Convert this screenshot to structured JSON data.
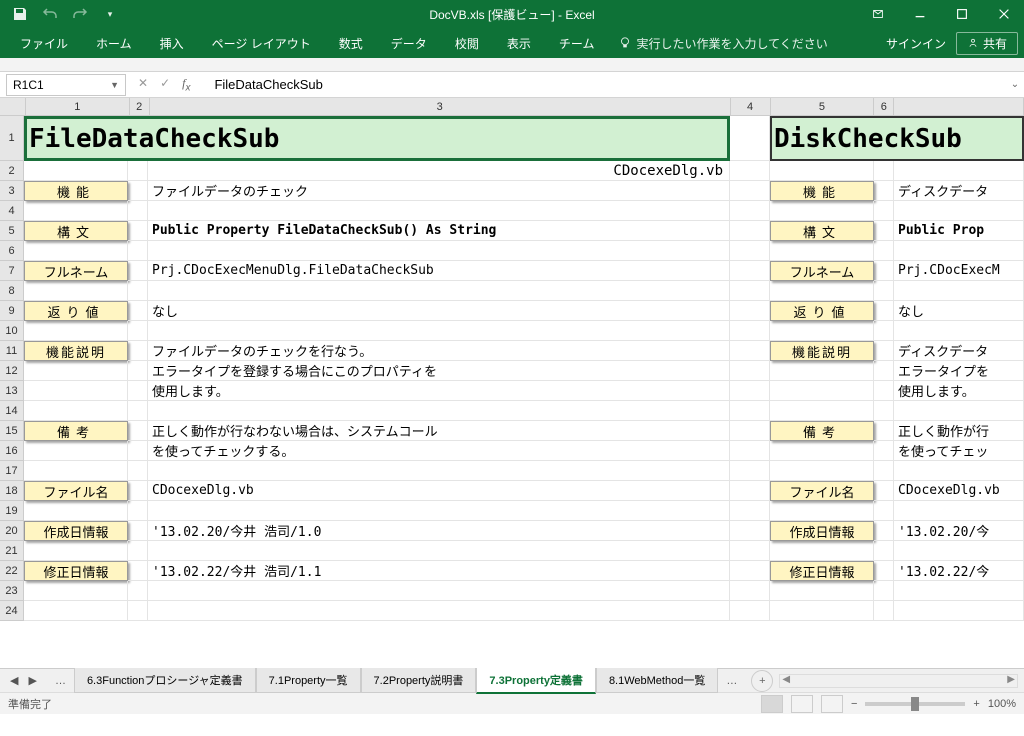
{
  "titlebar": {
    "title": "DocVB.xls [保護ビュー] - Excel"
  },
  "ribbon": {
    "tabs": [
      "ファイル",
      "ホーム",
      "挿入",
      "ページ レイアウト",
      "数式",
      "データ",
      "校閲",
      "表示",
      "チーム"
    ],
    "tellme": "実行したい作業を入力してください",
    "signin": "サインイン",
    "share": "共有"
  },
  "namebox": "R1C1",
  "formula": "FileDataCheckSub",
  "cols": [
    "1",
    "2",
    "3",
    "4",
    "5",
    "6",
    ""
  ],
  "rows": [
    "1",
    "2",
    "3",
    "4",
    "5",
    "6",
    "7",
    "8",
    "9",
    "10",
    "11",
    "12",
    "13",
    "14",
    "15",
    "16",
    "17",
    "18",
    "19",
    "20",
    "21",
    "22",
    "23",
    "24"
  ],
  "left": {
    "title": "FileDataCheckSub",
    "subtitle": "CDocexeDlg.vb",
    "labels": {
      "func": "機能",
      "syntax": "構文",
      "fullname": "フルネーム",
      "return": "返り値",
      "desc": "機能説明",
      "remark": "備考",
      "file": "ファイル名",
      "created": "作成日情報",
      "modified": "修正日情報"
    },
    "values": {
      "func": "ファイルデータのチェック",
      "syntax": "Public Property FileDataCheckSub() As String",
      "fullname": "Prj.CDocExecMenuDlg.FileDataCheckSub",
      "return": "なし",
      "desc1": "ファイルデータのチェックを行なう。",
      "desc2": "エラータイプを登録する場合にこのプロパティを",
      "desc3": "使用します。",
      "remark1": "正しく動作が行なわない場合は、システムコール",
      "remark2": "を使ってチェックする。",
      "file": "CDocexeDlg.vb",
      "created": "'13.02.20/今井 浩司/1.0",
      "modified": "'13.02.22/今井 浩司/1.1"
    }
  },
  "right": {
    "title": "DiskCheckSub",
    "values": {
      "func": "ディスクデータ",
      "syntax": "Public Prop",
      "fullname": "Prj.CDocExecM",
      "return": "なし",
      "desc1": "ディスクデータ",
      "desc2": "エラータイプを",
      "desc3": "使用します。",
      "remark1": "正しく動作が行",
      "remark2": "を使ってチェッ",
      "file": "CDocexeDlg.vb",
      "created": "'13.02.20/今",
      "modified": "'13.02.22/今"
    }
  },
  "sheets": {
    "tabs": [
      "6.3Functionプロシージャ定義書",
      "7.1Property一覧",
      "7.2Property説明書",
      "7.3Property定義書",
      "8.1WebMethod一覧"
    ],
    "active": 3
  },
  "status": {
    "ready": "準備完了",
    "zoom": "100%"
  }
}
